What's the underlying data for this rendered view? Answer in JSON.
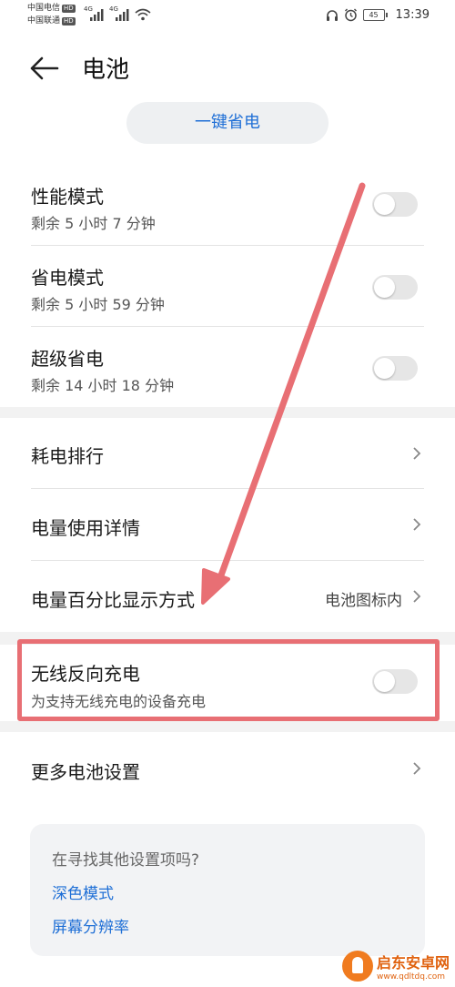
{
  "status_bar": {
    "carrier1": "中国电信",
    "carrier2": "中国联通",
    "hd": "HD",
    "net1": "4G",
    "net2": "4G",
    "battery_level": "45",
    "time": "13:39"
  },
  "header": {
    "title": "电池"
  },
  "one_key_button": {
    "label": "一键省电"
  },
  "modes": [
    {
      "title": "性能模式",
      "subtitle": "剩余 5 小时 7 分钟",
      "enabled": false
    },
    {
      "title": "省电模式",
      "subtitle": "剩余 5 小时 59 分钟",
      "enabled": false
    },
    {
      "title": "超级省电",
      "subtitle": "剩余 14 小时 18 分钟",
      "enabled": false
    }
  ],
  "nav_items": [
    {
      "title": "耗电排行"
    },
    {
      "title": "电量使用详情"
    },
    {
      "title": "电量百分比显示方式",
      "value": "电池图标内"
    }
  ],
  "wireless": {
    "title": "无线反向充电",
    "subtitle": "为支持无线充电的设备充电",
    "enabled": false
  },
  "more": {
    "title": "更多电池设置"
  },
  "search_card": {
    "question": "在寻找其他设置项吗?",
    "links": [
      "深色模式",
      "屏幕分辨率"
    ]
  },
  "watermark": {
    "name": "启东安卓网",
    "url": "www.qdltdq.com"
  },
  "colors": {
    "accent": "#1f6fd6",
    "annotation": "#e86f74",
    "toggle_off": "#e6e6e6"
  }
}
